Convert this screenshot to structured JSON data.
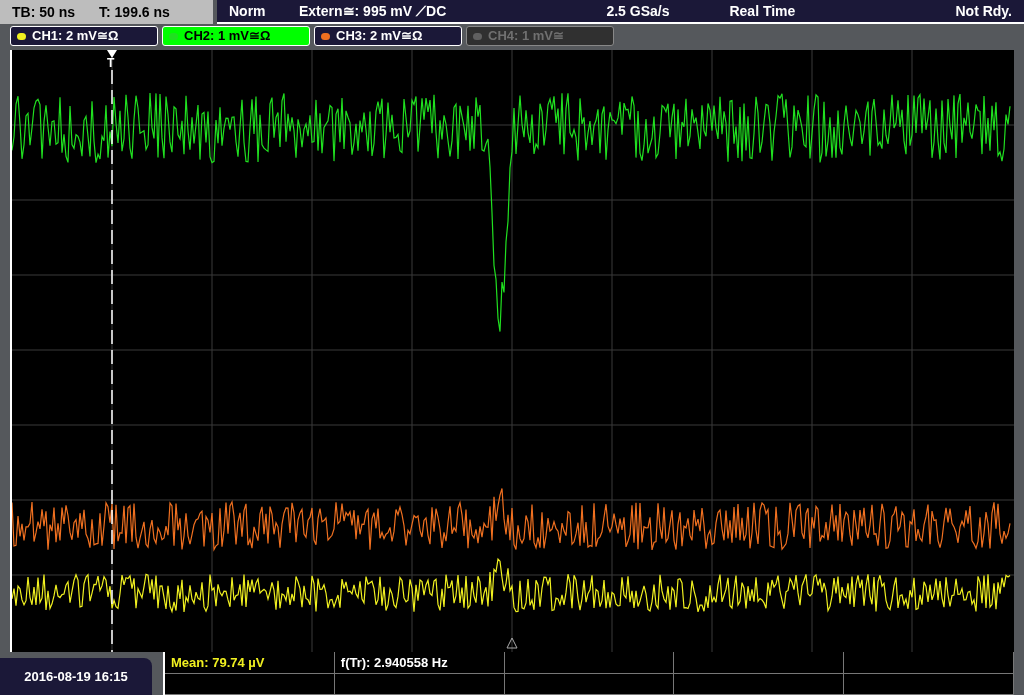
{
  "timebase": {
    "tb": "TB: 50 ns",
    "t": "T: 199.6 ns"
  },
  "status": {
    "mode": "Norm",
    "trigger": "Extern≅: 995 mV ⟋DC",
    "sample_rate": "2.5 GSa/s",
    "acquisition": "Real Time",
    "state": "Not Rdy."
  },
  "channels": [
    {
      "label": "CH1: 2 mV≅Ω",
      "color": "#f0f020",
      "selected": false,
      "disabled": false
    },
    {
      "label": "CH2: 1 mV≅Ω",
      "color": "#20e020",
      "selected": true,
      "disabled": false
    },
    {
      "label": "CH3: 2 mV≅Ω",
      "color": "#f07020",
      "selected": false,
      "disabled": false
    },
    {
      "label": "CH4: 1 mV≅",
      "color": "#606060",
      "selected": false,
      "disabled": true
    }
  ],
  "trigger_marker": "T",
  "datetime": "2016-08-19 16:15",
  "measurements": [
    {
      "label": "Mean: 79.74 µV",
      "kind": "highlight"
    },
    {
      "label": "f(Tr): 2.940558 Hz",
      "kind": "plain"
    }
  ]
}
